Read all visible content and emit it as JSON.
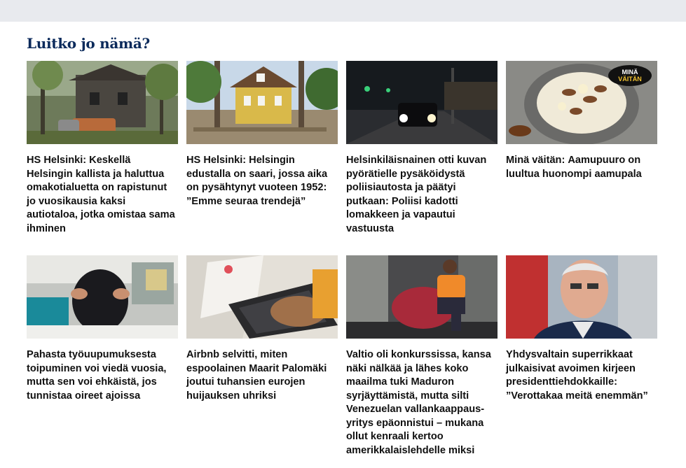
{
  "section_title": "Luitko jo nämä?",
  "articles": [
    {
      "section": "HS Helsinki:",
      "title": "Keskellä Helsingin kallista ja haluttua omakotialuetta on rapistunut jo vuosikausia kaksi autiotaloa, jotka omistaa sama ihminen",
      "image": "abandoned-house-photo"
    },
    {
      "section": "HS Helsinki:",
      "title": "Helsingin edustalla on saari, jossa aika on pysähtynyt vuoteen 1952: ”Emme seuraa trendejä”",
      "image": "yellow-villa-photo"
    },
    {
      "section": "",
      "title": "Helsinkiläisnainen otti kuvan pyörätielle pysäköidystä poliisiautosta ja päätyi putkaan: Poliisi kadotti lomakkeen ja vapautui vastuusta",
      "image": "police-car-night-photo"
    },
    {
      "section": "Minä väitän:",
      "title": "Aamupuuro on luultua huonompi aamupala",
      "image": "porridge-bowl-photo",
      "badge": {
        "line1": "MINÄ",
        "line2": "VÄITÄN"
      }
    },
    {
      "section": "",
      "title": "Pahasta työuupumuksesta toipuminen voi viedä vuosia, mutta sen voi ehkäistä, jos tunnistaa oireet ajoissa",
      "image": "stressed-person-photo"
    },
    {
      "section": "",
      "title": "Airbnb selvitti, miten espoolainen Maarit Palomäki joutui tuhansien eurojen huijauksen uhriksi",
      "image": "laptop-airbnb-photo"
    },
    {
      "section": "",
      "title": "Valtio oli konkurssissa, kansa näki nälkää ja lähes koko maailma tuki Maduron syrjäyttämistä, mutta silti Venezuelan vallankaappaus-yritys epäonnistui – mukana ollut kenraali kertoo amerikkalaislehdelle miksi",
      "image": "man-in-chair-photo"
    },
    {
      "section": "",
      "title": "Yhdysvaltain superrikkaat julkaisivat avoimen kirjeen presidenttiehdokkaille: ”Verottakaa meitä enemmän”",
      "image": "elderly-man-portrait-photo"
    }
  ]
}
